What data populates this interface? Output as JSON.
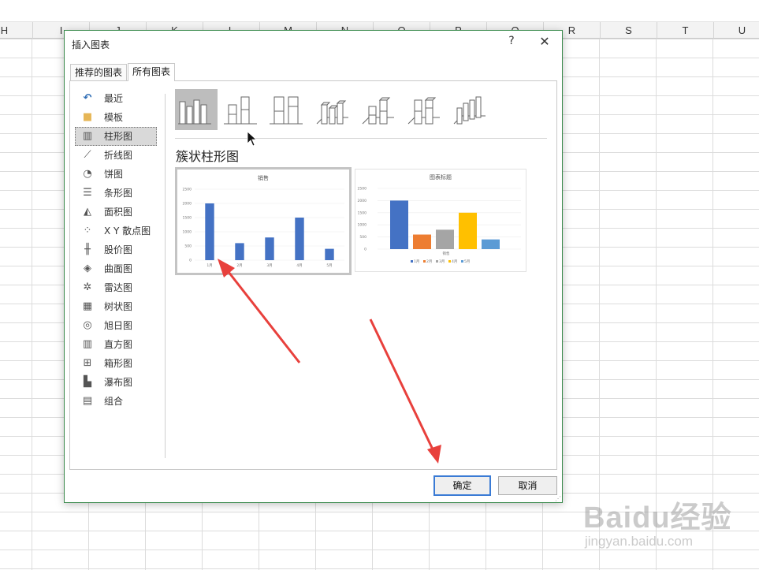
{
  "sheet": {
    "columns": [
      "H",
      "I",
      "J",
      "K",
      "L",
      "M",
      "N",
      "O",
      "P",
      "Q",
      "R",
      "S",
      "T",
      "U"
    ]
  },
  "dialog": {
    "title": "插入图表",
    "help_glyph": "?",
    "close_glyph": "✕",
    "tabs": [
      {
        "label": "推荐的图表",
        "active": false
      },
      {
        "label": "所有图表",
        "active": true
      }
    ],
    "categories": [
      {
        "label": "最近",
        "icon": "recent-icon"
      },
      {
        "label": "模板",
        "icon": "folder-icon"
      },
      {
        "label": "柱形图",
        "icon": "column-chart-icon",
        "selected": true
      },
      {
        "label": "折线图",
        "icon": "line-chart-icon"
      },
      {
        "label": "饼图",
        "icon": "pie-chart-icon"
      },
      {
        "label": "条形图",
        "icon": "bar-chart-icon"
      },
      {
        "label": "面积图",
        "icon": "area-chart-icon"
      },
      {
        "label": "X Y 散点图",
        "icon": "scatter-chart-icon"
      },
      {
        "label": "股价图",
        "icon": "stock-chart-icon"
      },
      {
        "label": "曲面图",
        "icon": "surface-chart-icon"
      },
      {
        "label": "雷达图",
        "icon": "radar-chart-icon"
      },
      {
        "label": "树状图",
        "icon": "treemap-chart-icon"
      },
      {
        "label": "旭日图",
        "icon": "sunburst-chart-icon"
      },
      {
        "label": "直方图",
        "icon": "histogram-chart-icon"
      },
      {
        "label": "箱形图",
        "icon": "box-whisker-chart-icon"
      },
      {
        "label": "瀑布图",
        "icon": "waterfall-chart-icon"
      },
      {
        "label": "组合",
        "icon": "combo-chart-icon"
      }
    ],
    "variant_title": "簇状柱形图",
    "ok_label": "确定",
    "cancel_label": "取消"
  },
  "chart_data": [
    {
      "type": "bar",
      "title": "销售",
      "categories": [
        "1月",
        "2月",
        "3月",
        "4月",
        "5月"
      ],
      "values": [
        2000,
        600,
        800,
        1500,
        400
      ],
      "ylim": [
        0,
        2500
      ],
      "yticks": [
        "2500",
        "2000",
        "1500",
        "1000",
        "500",
        "0"
      ],
      "color": "#4472c4",
      "legend": "none"
    },
    {
      "type": "bar",
      "title": "图表标题",
      "xlabel": "销售",
      "series": [
        {
          "name": "1月",
          "values": [
            2000
          ],
          "color": "#4472c4"
        },
        {
          "name": "2月",
          "values": [
            600
          ],
          "color": "#ed7d31"
        },
        {
          "name": "3月",
          "values": [
            800
          ],
          "color": "#a5a5a5"
        },
        {
          "name": "4月",
          "values": [
            1500
          ],
          "color": "#ffc000"
        },
        {
          "name": "5月",
          "values": [
            400
          ],
          "color": "#5b9bd5"
        }
      ],
      "ylim": [
        0,
        2500
      ],
      "yticks": [
        "2500",
        "2000",
        "1500",
        "1000",
        "500",
        "0"
      ],
      "legend": "bottom"
    }
  ],
  "watermark": {
    "logo_text": "Baidu经验",
    "url": "jingyan.baidu.com"
  }
}
